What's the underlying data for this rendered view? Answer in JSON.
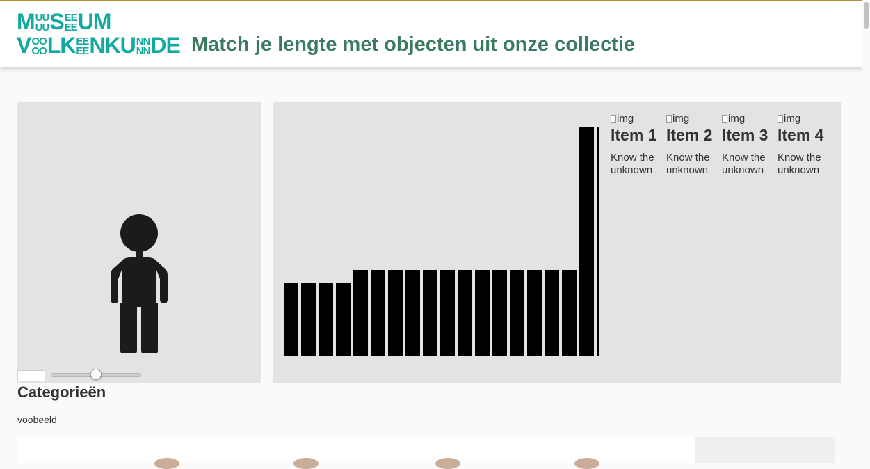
{
  "header": {
    "logo_row1": {
      "a": "M",
      "b1": "UU",
      "b2": "UU",
      "c": "S",
      "d1": "EE",
      "d2": "EE",
      "e": "UM"
    },
    "logo_row2": {
      "a": "V",
      "b1": "OO",
      "b2": "OO",
      "c": "LK",
      "d1": "EE",
      "d2": "EE",
      "e": "NKU",
      "f1": "NN",
      "f2": "NN",
      "g": "DE"
    },
    "title": "Match je lengte met objecten uit onze collectie"
  },
  "height_control": {
    "input_value": "",
    "slider_value_fraction": 0.52
  },
  "chart_data": {
    "type": "bar",
    "values": [
      105,
      105,
      105,
      105,
      124,
      124,
      124,
      124,
      124,
      124,
      124,
      124,
      124,
      124,
      124,
      124,
      124,
      329,
      329
    ],
    "ylim": [
      0,
      366
    ],
    "categories": []
  },
  "items": [
    {
      "img_alt": "img",
      "title": "Item 1",
      "desc": "Know the unknown"
    },
    {
      "img_alt": "img",
      "title": "Item 2",
      "desc": "Know the unknown"
    },
    {
      "img_alt": "img",
      "title": "Item 3",
      "desc": "Know the unknown"
    },
    {
      "img_alt": "img",
      "title": "Item 4",
      "desc": "Know the unknown"
    }
  ],
  "categories": {
    "title": "Categorieën",
    "items": [
      "voobeeld"
    ]
  },
  "colors": {
    "logo": "#12a9a0",
    "title": "#3a7a60",
    "panel": "#e3e3e3",
    "bar": "#000000",
    "figure": "#1b1b1b"
  }
}
